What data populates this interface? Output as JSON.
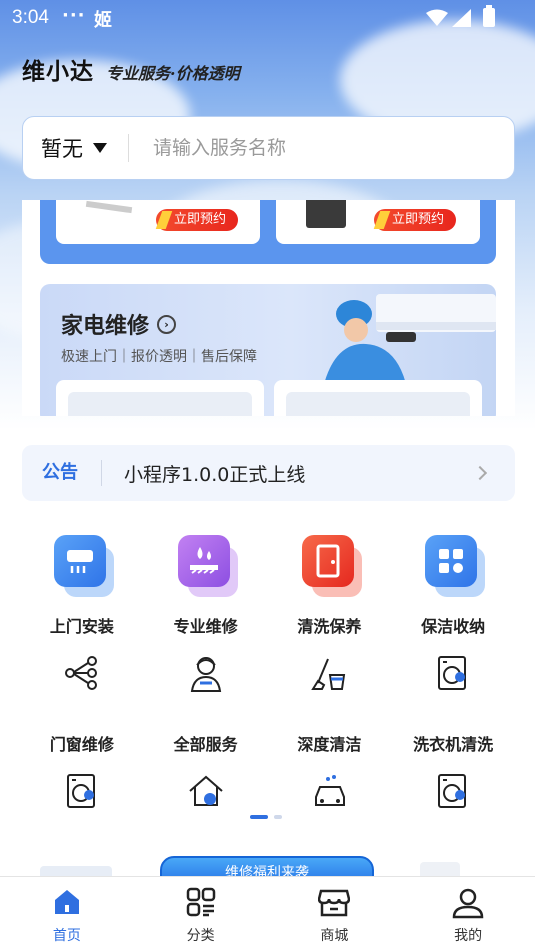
{
  "status_bar": {
    "time": "3:04",
    "dots": "···",
    "app_glyph": "姬",
    "icons": [
      "wifi-icon",
      "signal-icon",
      "battery-icon"
    ]
  },
  "brand": {
    "name": "维小达",
    "slogan": "专业服务·价格透明"
  },
  "search": {
    "city": "暂无",
    "placeholder": "请输入服务名称"
  },
  "install_section": {
    "book_label_1": "立即预约",
    "book_label_2": "立即预约"
  },
  "repair_section": {
    "title": "家电维修",
    "subtitle": "极速上门｜报价透明｜售后保障"
  },
  "notice": {
    "tag": "公告",
    "text": "小程序1.0.0正式上线"
  },
  "services": [
    {
      "label": "上门安装",
      "icon": "air-conditioner-icon",
      "color": "#3f8bf0"
    },
    {
      "label": "专业维修",
      "icon": "water-drop-icon",
      "color": "#a965ea"
    },
    {
      "label": "清洗保养",
      "icon": "door-icon",
      "color": "#f0452f"
    },
    {
      "label": "保洁收纳",
      "icon": "grid-apps-icon",
      "color": "#3f8bf0"
    },
    {
      "label": "门窗维修",
      "icon": "share-nodes-icon"
    },
    {
      "label": "全部服务",
      "icon": "worker-icon"
    },
    {
      "label": "深度清洁",
      "icon": "broom-bucket-icon"
    },
    {
      "label": "洗衣机清洗",
      "icon": "washing-machine-icon"
    },
    {
      "icon": "washing-machine-icon"
    },
    {
      "icon": "house-repair-icon"
    },
    {
      "icon": "car-wash-icon"
    },
    {
      "icon": "washing-machine-icon"
    }
  ],
  "promo_banner": "维修福利来袭",
  "tabs": [
    {
      "label": "首页",
      "icon": "home-icon",
      "active": true
    },
    {
      "label": "分类",
      "icon": "category-icon"
    },
    {
      "label": "商城",
      "icon": "shop-icon"
    },
    {
      "label": "我的",
      "icon": "user-icon"
    }
  ],
  "colors": {
    "accent": "#2f6fe0",
    "book_button": "#e8261d",
    "install_block": "#5b95ee"
  }
}
